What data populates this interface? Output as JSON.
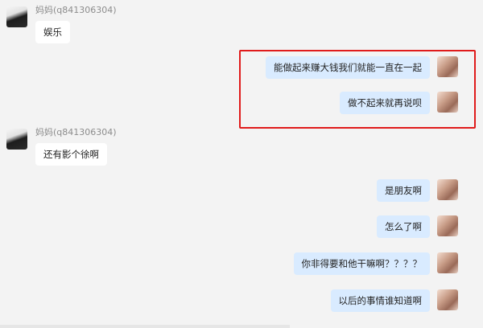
{
  "conversation": {
    "highlight_color": "#e01b1b",
    "incoming_bubble_color": "#ffffff",
    "outgoing_bubble_color": "#d9ebff",
    "messages": [
      {
        "direction": "in",
        "sender": "妈妈(q841306304)",
        "text": "娱乐"
      },
      {
        "direction": "out",
        "text": "能做起来赚大钱我们就能一直在一起"
      },
      {
        "direction": "out",
        "text": "做不起来就再说呗"
      },
      {
        "direction": "in",
        "sender": "妈妈(q841306304)",
        "text": "还有影个徐啊"
      },
      {
        "direction": "out",
        "text": "是朋友啊"
      },
      {
        "direction": "out",
        "text": "怎么了啊"
      },
      {
        "direction": "out",
        "text": "你非得要和他干嘛啊？？？？"
      },
      {
        "direction": "out",
        "text": "以后的事情谁知道啊"
      }
    ]
  }
}
